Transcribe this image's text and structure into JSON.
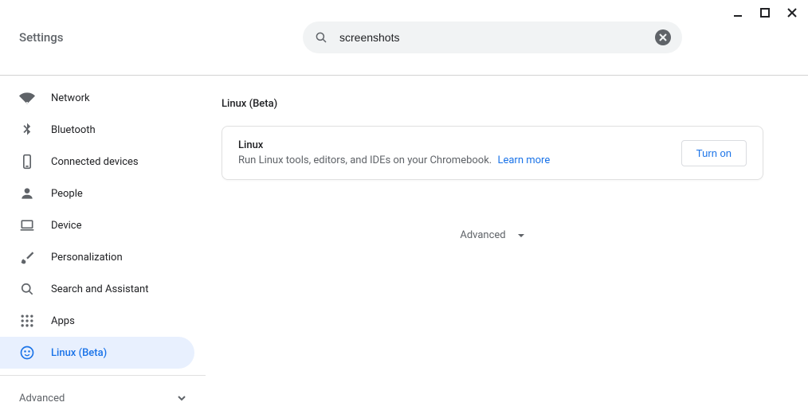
{
  "window": {
    "title": "Settings"
  },
  "search": {
    "value": "screenshots"
  },
  "sidebar": {
    "items": [
      {
        "label": "Network"
      },
      {
        "label": "Bluetooth"
      },
      {
        "label": "Connected devices"
      },
      {
        "label": "People"
      },
      {
        "label": "Device"
      },
      {
        "label": "Personalization"
      },
      {
        "label": "Search and Assistant"
      },
      {
        "label": "Apps"
      },
      {
        "label": "Linux (Beta)"
      }
    ],
    "advanced_label": "Advanced"
  },
  "main": {
    "section_title": "Linux (Beta)",
    "card": {
      "title": "Linux",
      "description": "Run Linux tools, editors, and IDEs on your Chromebook.",
      "learn_more": "Learn more",
      "button": "Turn on"
    },
    "advanced_label": "Advanced"
  }
}
